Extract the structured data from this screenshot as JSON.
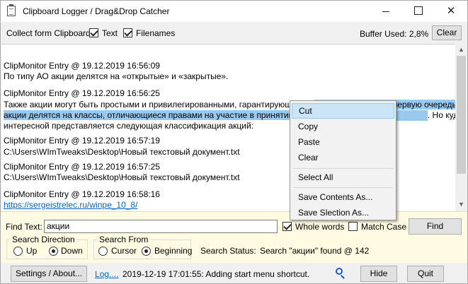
{
  "window": {
    "title": "Clipboard Logger / Drag&Drop Catcher",
    "minimize": "—",
    "maximize": "",
    "close": "✕"
  },
  "toolbar": {
    "collect_label": "Collect form Clipboard:",
    "text_label": "Text",
    "text_checked": true,
    "filenames_label": "Filenames",
    "filenames_checked": true,
    "buffer_used": "Buffer Used: 2,8%",
    "clear_label": "Clear"
  },
  "log": {
    "entries": [
      {
        "header": "ClipMonitor Entry @ 19.12.2019 16:56:09",
        "line1": "По типу АО акции делятся на «открытые» и «закрытые»."
      },
      {
        "header": "ClipMonitor Entry @ 19.12.2019 16:56:25",
        "line1a": "Также акции могут быть простыми и привилегированными, гарантирующими в",
        "line1b": "В первую очередь простые",
        "line2a": "акции делятся на классы, отличающиеся правами на участие в принятии решен",
        "line2b": ". Но куда более",
        "line3": "интересной представляется следующая классификация акций:"
      },
      {
        "header": "ClipMonitor Entry @ 19.12.2019 16:57:19",
        "line1": "C:\\Users\\WImTweaks\\Desktop\\Новый текстовый документ.txt"
      },
      {
        "header": "ClipMonitor Entry @ 19.12.2019 16:57:25",
        "line1": "C:\\Users\\WImTweaks\\Desktop\\Новый текстовый документ.txt"
      },
      {
        "header": "ClipMonitor Entry @ 19.12.2019 16:58:16",
        "link": "https://sergeistrelec.ru/winpe_10_8/"
      }
    ]
  },
  "context_menu": {
    "items": [
      "Cut",
      "Copy",
      "Paste",
      "Clear",
      "Select All",
      "Save Contents As...",
      "Save Slection As..."
    ],
    "highlighted": "Cut"
  },
  "find": {
    "label": "Find Text:",
    "value": "акции",
    "whole_words_label": "Whole words",
    "whole_words_checked": true,
    "match_case_label": "Match Case",
    "match_case_checked": false,
    "find_button": "Find",
    "direction_title": "Search Direction",
    "up_label": "Up",
    "down_label": "Down",
    "direction_selected": "Down",
    "from_title": "Search From",
    "cursor_label": "Cursor",
    "beginning_label": "Beginning",
    "from_selected": "Beginning",
    "status_label": "Search Status:",
    "status_value": "Search \"акции\" found @ 142"
  },
  "statusbar": {
    "settings_button": "Settings / About...",
    "log_link": "Log....",
    "message": "2019-12-19 17:01:55: Adding start menu shortcut.",
    "hide_button": "Hide",
    "quit_button": "Quit"
  },
  "icons": {
    "app": "clipboard-icon",
    "search": "magnifier-icon"
  },
  "colors": {
    "selection": "#99c9ef",
    "find_panel_bg": "#fffbe3",
    "link": "#0066cc",
    "menu_highlight": "#cce4f7"
  }
}
